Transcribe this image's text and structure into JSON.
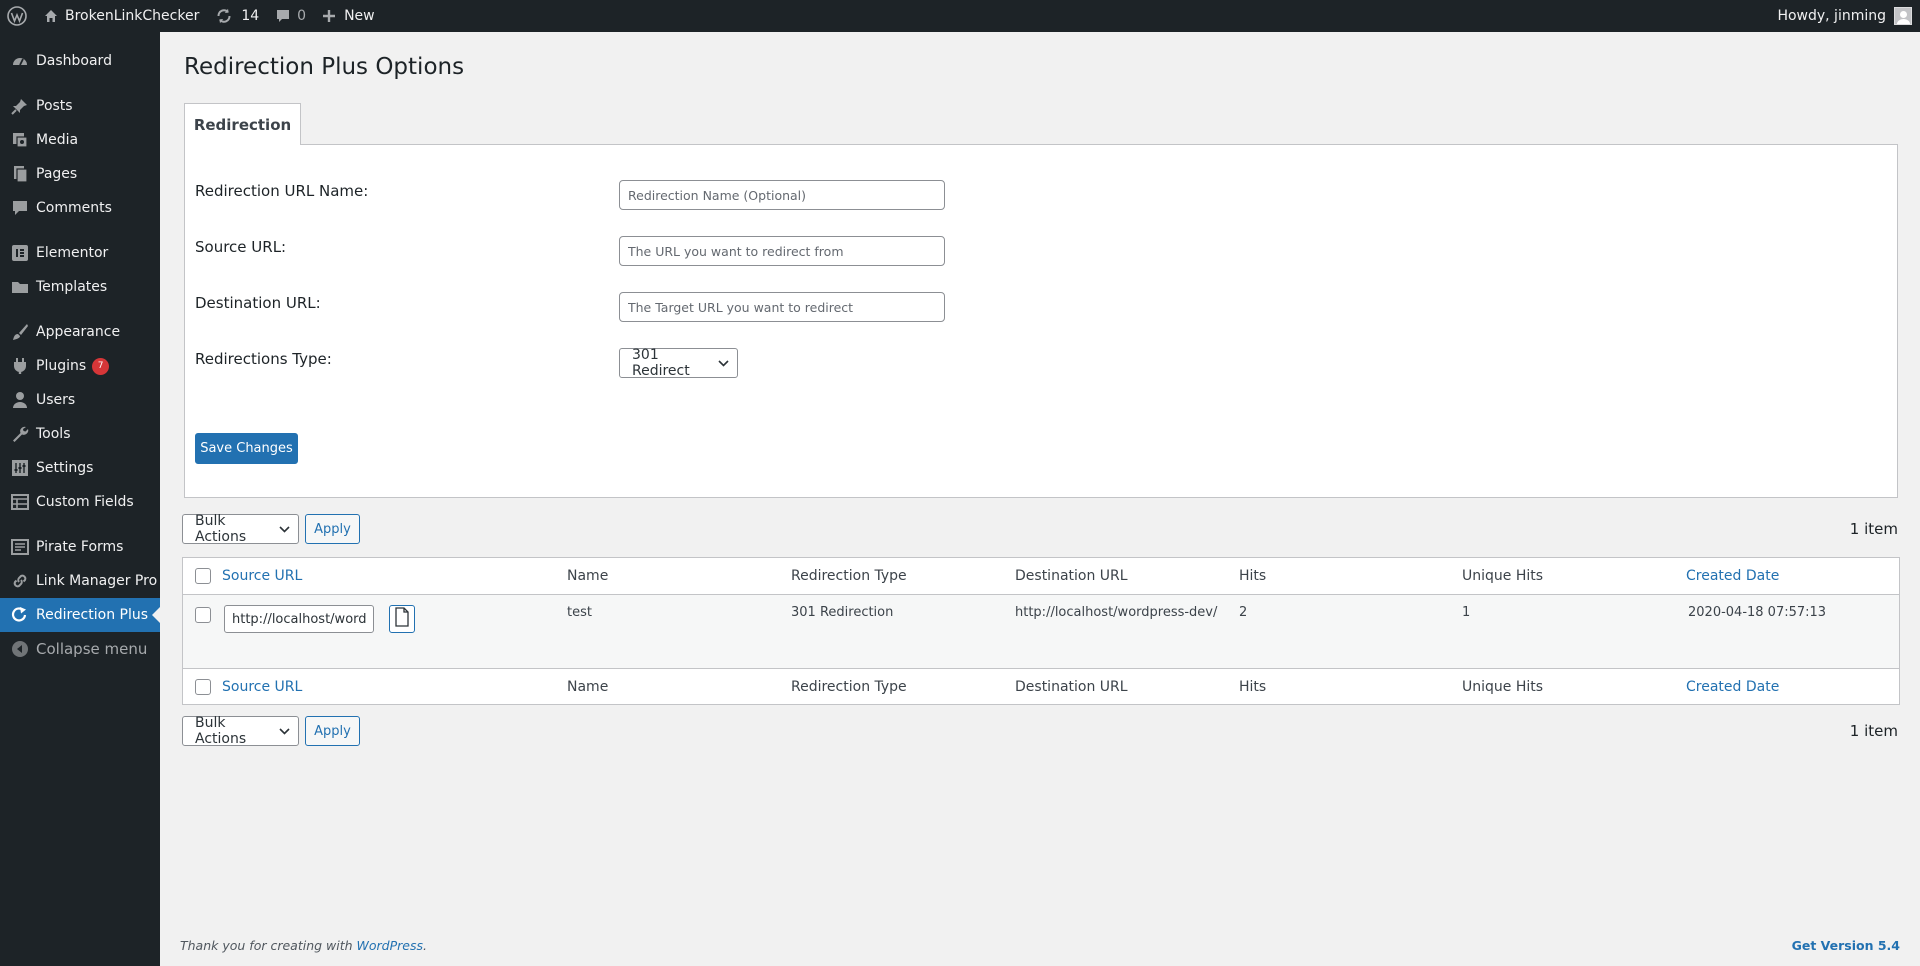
{
  "adminbar": {
    "site_name": "BrokenLinkChecker",
    "updates_count": "14",
    "comments_count": "0",
    "new_label": "New",
    "greeting": "Howdy, jinming"
  },
  "sidebar": {
    "items": [
      {
        "label": "Dashboard",
        "icon": "dashboard-icon"
      },
      {
        "label": "Posts",
        "icon": "pin-icon"
      },
      {
        "label": "Media",
        "icon": "media-icon"
      },
      {
        "label": "Pages",
        "icon": "pages-icon"
      },
      {
        "label": "Comments",
        "icon": "comment-icon"
      },
      {
        "label": "Elementor",
        "icon": "elementor-icon"
      },
      {
        "label": "Templates",
        "icon": "folder-icon"
      },
      {
        "label": "Appearance",
        "icon": "brush-icon"
      },
      {
        "label": "Plugins",
        "icon": "plugin-icon",
        "badge": "7"
      },
      {
        "label": "Users",
        "icon": "user-icon"
      },
      {
        "label": "Tools",
        "icon": "wrench-icon"
      },
      {
        "label": "Settings",
        "icon": "settings-icon"
      },
      {
        "label": "Custom Fields",
        "icon": "grid-icon"
      },
      {
        "label": "Pirate Forms",
        "icon": "form-icon"
      },
      {
        "label": "Link Manager Pro",
        "icon": "link-icon"
      },
      {
        "label": "Redirection Plus",
        "icon": "redirect-icon",
        "active": true
      }
    ],
    "collapse_label": "Collapse menu"
  },
  "page": {
    "title": "Redirection Plus Options",
    "tab_label": "Redirection"
  },
  "form": {
    "name_label": "Redirection URL Name:",
    "name_placeholder": "Redirection Name (Optional)",
    "source_label": "Source URL:",
    "source_placeholder": "The URL you want to redirect from",
    "dest_label": "Destination URL:",
    "dest_placeholder": "The Target URL you want to redirect",
    "type_label": "Redirections Type:",
    "type_value": "301 Redirect",
    "save_label": "Save Changes"
  },
  "tablenav": {
    "bulk_label": "Bulk Actions",
    "apply_label": "Apply",
    "items_count": "1 item"
  },
  "table": {
    "columns": [
      "Source URL",
      "Name",
      "Redirection Type",
      "Destination URL",
      "Hits",
      "Unique Hits",
      "Created Date"
    ],
    "rows": [
      {
        "source_url": "http://localhost/wordp",
        "name": "test",
        "type": "301 Redirection",
        "destination": "http://localhost/wordpress-dev/",
        "hits": "2",
        "unique_hits": "1",
        "created": "2020-04-18 07:57:13"
      }
    ]
  },
  "footer": {
    "thanks_text": "Thank you for creating with",
    "wp_link": "WordPress",
    "period": ".",
    "version": "Get Version 5.4"
  },
  "colors": {
    "adminbar_bg": "#1d2327",
    "accent": "#2271b1",
    "badge": "#d63638"
  }
}
